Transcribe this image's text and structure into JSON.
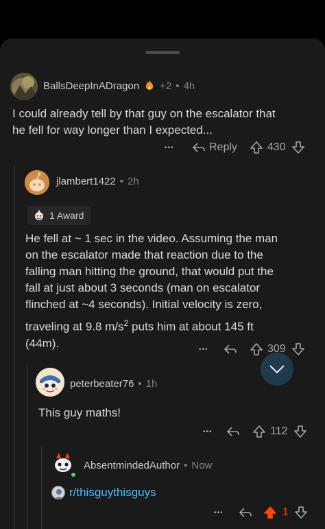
{
  "comments": [
    {
      "username": "BallsDeepInADragon",
      "extra": "+2",
      "time": "4h",
      "text_line1": "I could already tell by that guy on the escalator that",
      "text_line2": "he fell for way longer than I expected...",
      "reply_label": "Reply",
      "score": "430"
    },
    {
      "username": "jlambert1422",
      "time": "2h",
      "award_label": "1 Award",
      "text_lines": [
        "He fell at ~ 1 sec in the video. Assuming the man",
        "on the escalator made that reaction due to the",
        "falling man hitting the ground, that would put the",
        "fall at just about 3 seconds (man on escalator",
        "flinched at ~4 seconds). Initial velocity is zero,"
      ],
      "text_line6_pre": "traveling at 9.8 m/s",
      "text_line6_sup": "2",
      "text_line6_post": " puts him at about 145 ft",
      "text_line7": "(44m).",
      "score": "309"
    },
    {
      "username": "peterbeater76",
      "time": "1h",
      "text": "This guy maths!",
      "score": "112"
    },
    {
      "username": "AbsentmindedAuthor",
      "time": "Now",
      "link_text": "r/thisguythisguys",
      "score": "1"
    }
  ],
  "separator": "•",
  "more_glyph": "•••",
  "colors": {
    "background": "#1a1a1b",
    "upvote_active": "#ff4500",
    "link": "#4fbcff"
  }
}
